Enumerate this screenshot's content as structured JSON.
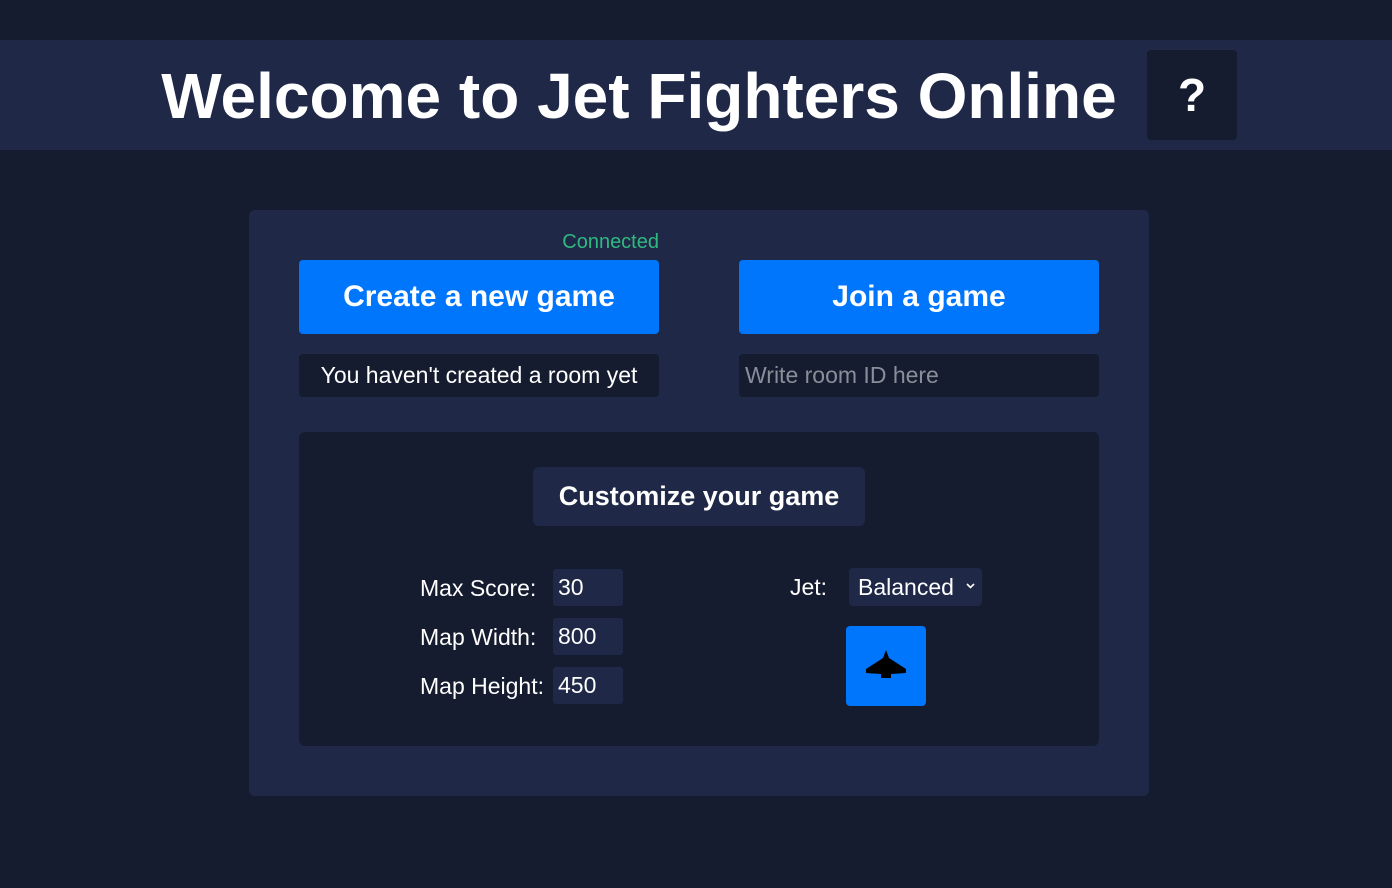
{
  "header": {
    "title": "Welcome to Jet Fighters Online",
    "help_label": "?"
  },
  "lobby": {
    "connection_status": "Connected",
    "create_label": "Create a new game",
    "join_label": "Join a game",
    "room_status": "You haven't created a room yet",
    "room_id_placeholder": "Write room ID here"
  },
  "customize": {
    "title": "Customize your game",
    "max_score_label": "Max Score:",
    "max_score_value": "30",
    "map_width_label": "Map Width:",
    "map_width_value": "800",
    "map_height_label": "Map Height:",
    "map_height_value": "450",
    "jet_label": "Jet:",
    "jet_selected": "Balanced",
    "jet_icon": "jet-icon"
  },
  "colors": {
    "background": "#151c2f",
    "panel": "#1f2947",
    "accent": "#0076fd",
    "connected": "#2fb980"
  }
}
